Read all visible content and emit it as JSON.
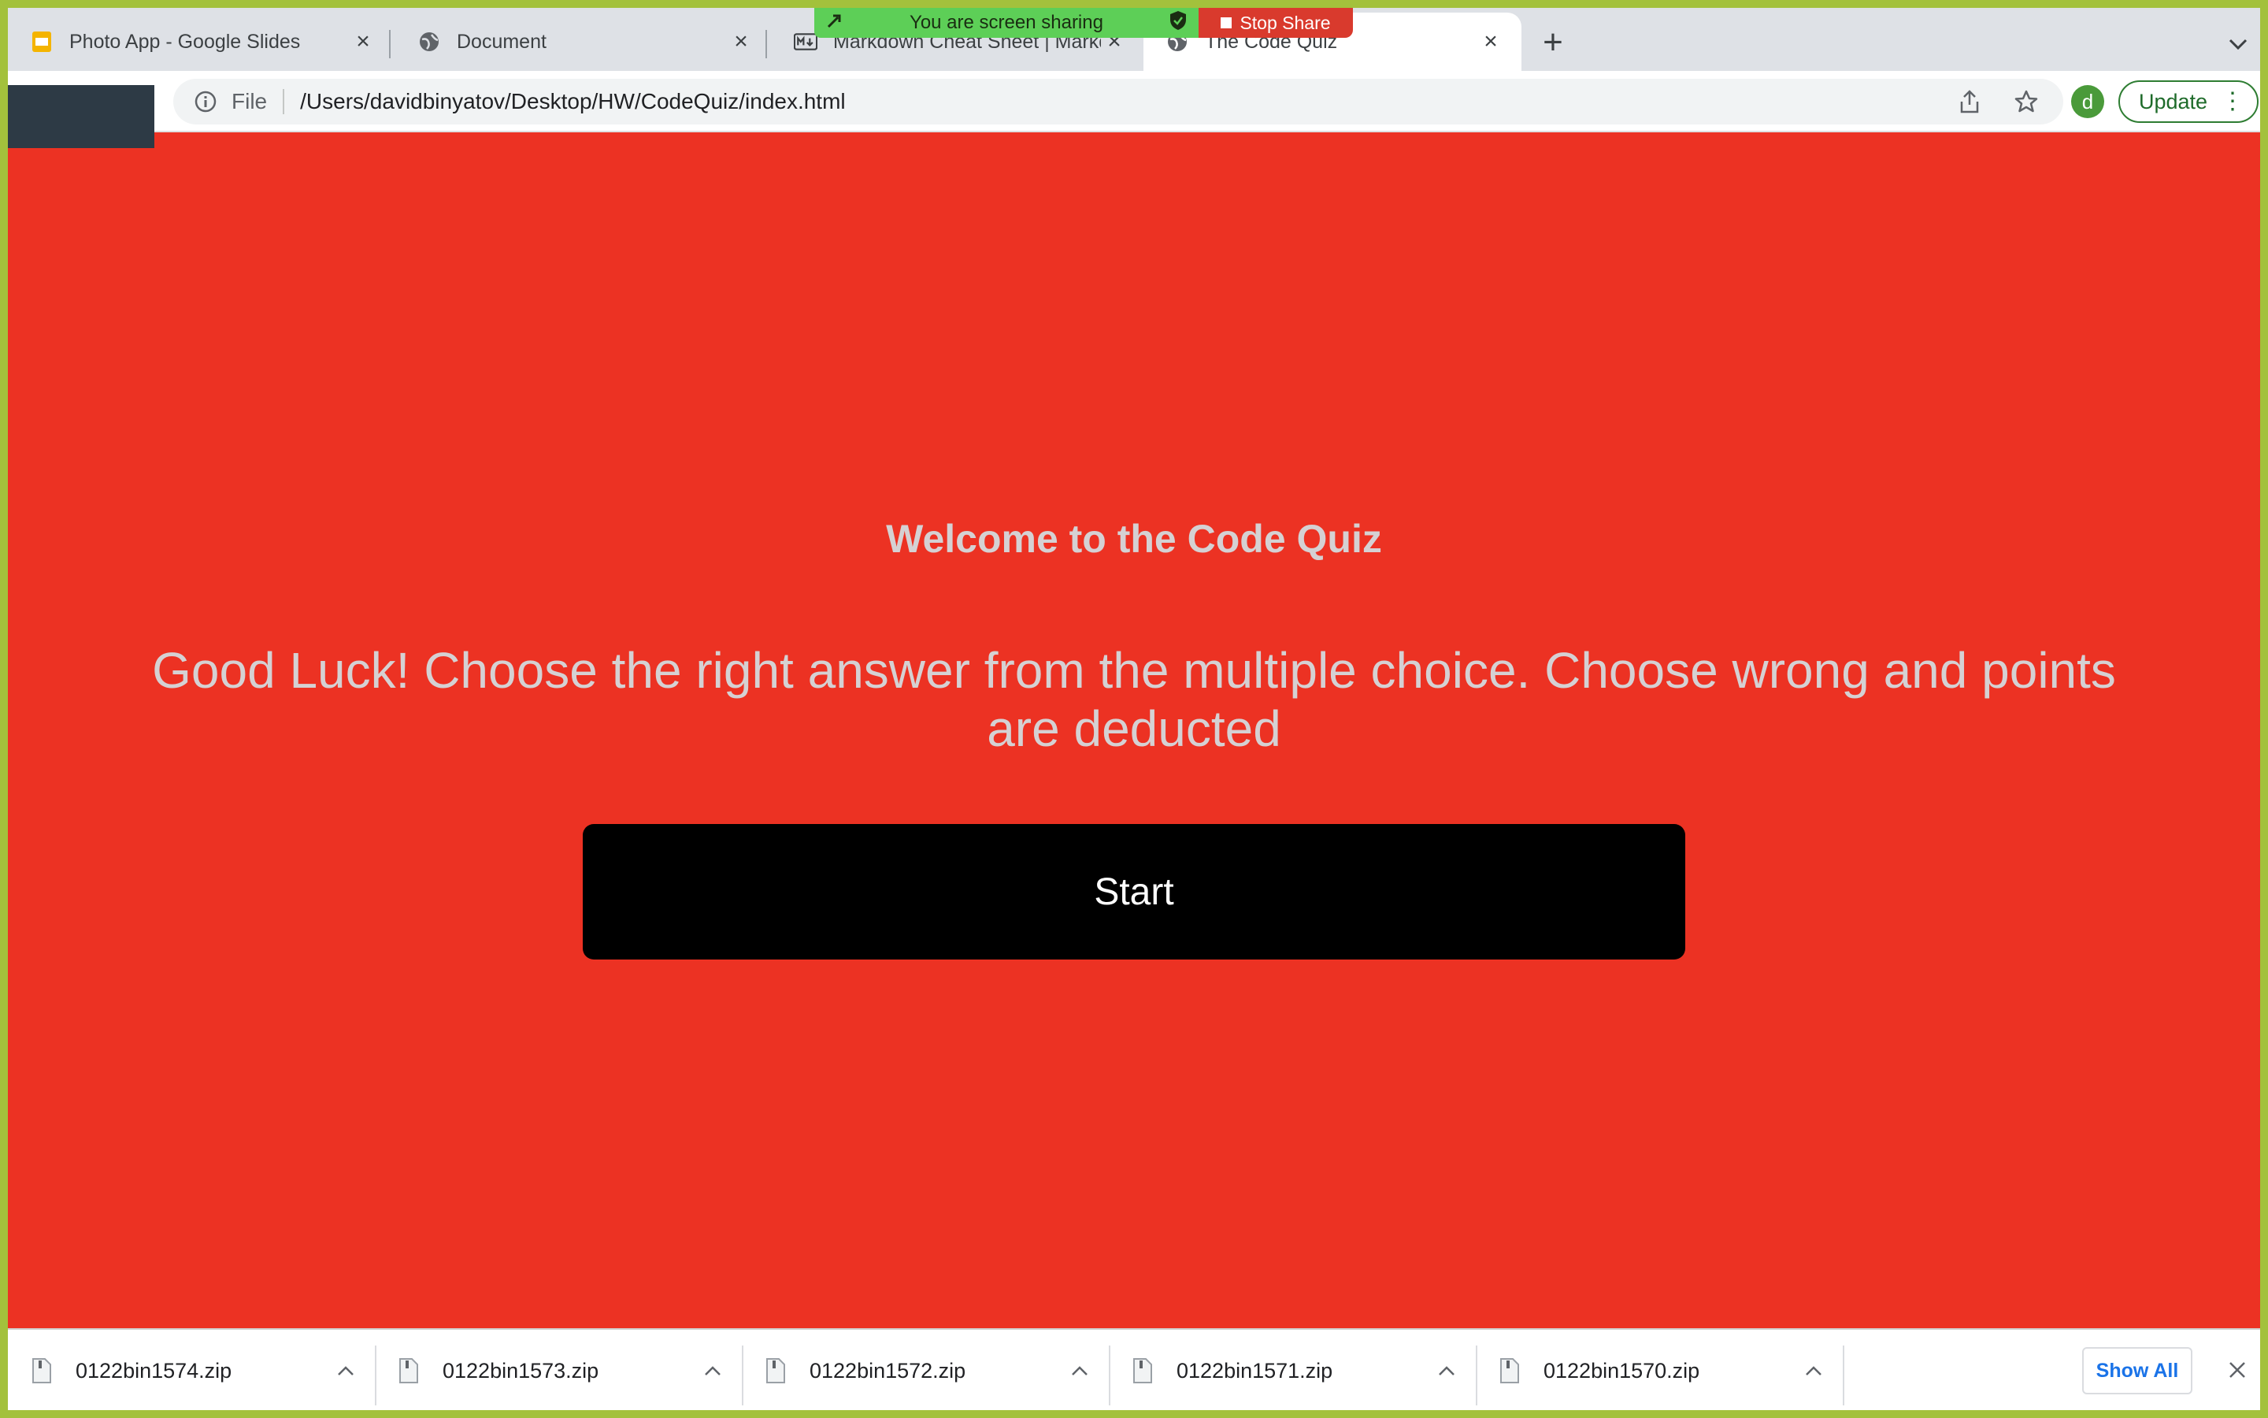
{
  "browser": {
    "tabs": [
      {
        "title": "Photo App - Google Slides",
        "favicon": "slides-icon",
        "active": false
      },
      {
        "title": "Document",
        "favicon": "globe-icon",
        "active": false
      },
      {
        "title": "Markdown Cheat Sheet | Markdo",
        "favicon": "markdown-icon",
        "active": false
      },
      {
        "title": "The Code Quiz",
        "favicon": "globe-icon",
        "active": true
      }
    ],
    "new_tab_symbol": "+",
    "screen_share": {
      "message": "You are screen sharing",
      "stop_label": "Stop Share"
    },
    "address": {
      "scheme": "File",
      "url": "/Users/davidbinyatov/Desktop/HW/CodeQuiz/index.html"
    },
    "profile_initial": "d",
    "update_label": "Update"
  },
  "page": {
    "heading": "Welcome to the Code Quiz",
    "instructions": "Good Luck! Choose the right answer from the multiple choice. Choose wrong and points are deducted",
    "start_label": "Start",
    "colors": {
      "background": "#ec3223",
      "button": "#000000",
      "text": "#d5d1d3"
    }
  },
  "downloads": {
    "items": [
      {
        "name": "0122bin1574.zip"
      },
      {
        "name": "0122bin1573.zip"
      },
      {
        "name": "0122bin1572.zip"
      },
      {
        "name": "0122bin1571.zip"
      },
      {
        "name": "0122bin1570.zip"
      }
    ],
    "show_all_label": "Show All"
  }
}
